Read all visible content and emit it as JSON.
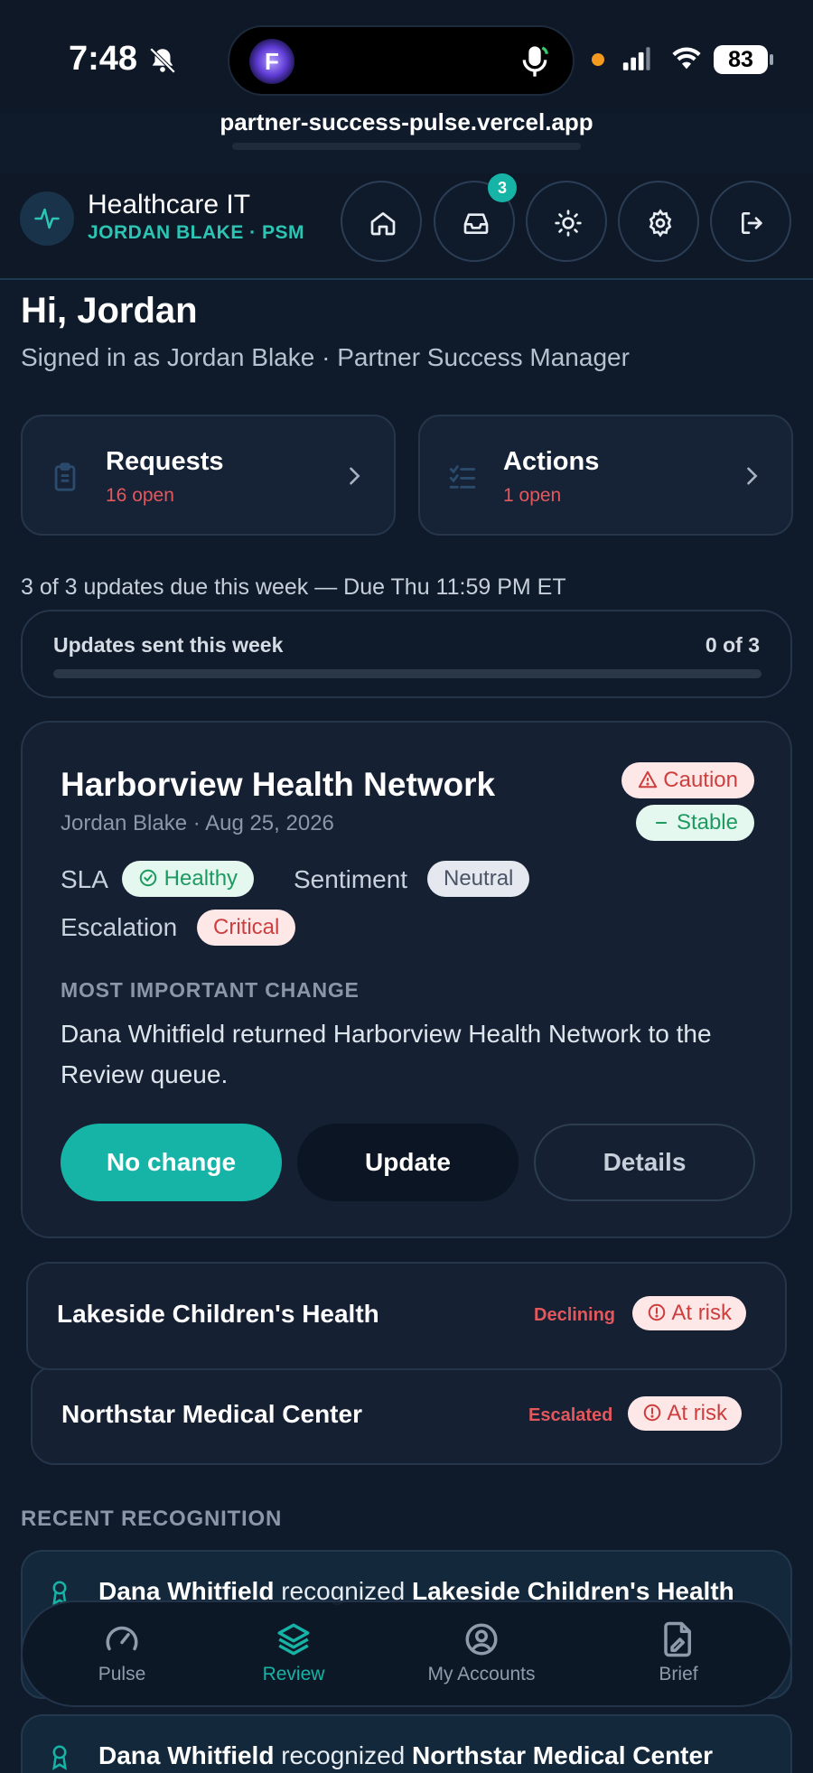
{
  "status_bar": {
    "time": "7:48",
    "battery": "83"
  },
  "browser": {
    "url": "partner-success-pulse.vercel.app",
    "app_letter": "F"
  },
  "header": {
    "org_title": "Healthcare IT",
    "org_subtitle": "JORDAN BLAKE · PSM",
    "inbox_badge": "3"
  },
  "greeting": {
    "title": "Hi, Jordan",
    "subtitle": "Signed in as Jordan Blake · Partner Success Manager"
  },
  "quick_cards": [
    {
      "title": "Requests",
      "count": "16 open"
    },
    {
      "title": "Actions",
      "count": "1 open"
    }
  ],
  "updates": {
    "due_line": "3 of 3 updates due this week — Due Thu 11:59 PM ET",
    "label": "Updates sent this week",
    "value": "0 of 3",
    "progress_fraction": 0
  },
  "account": {
    "name": "Harborview Health Network",
    "meta": "Jordan Blake · Aug 25, 2026",
    "badge_caution": "Caution",
    "badge_trend": "Stable",
    "sla_label": "SLA",
    "sla_value": "Healthy",
    "sentiment_label": "Sentiment",
    "sentiment_value": "Neutral",
    "escalation_label": "Escalation",
    "escalation_value": "Critical",
    "change_label": "MOST IMPORTANT CHANGE",
    "change_text": "Dana Whitfield returned Harborview Health Network to the Review queue.",
    "buttons": {
      "no_change": "No change",
      "update": "Update",
      "details": "Details"
    }
  },
  "queue": [
    {
      "name": "Lakeside Children's Health",
      "tag": "Declining",
      "status": "At risk"
    },
    {
      "name": "Northstar Medical Center",
      "tag": "Escalated",
      "status": "At risk"
    }
  ],
  "recognition": {
    "title": "RECENT RECOGNITION",
    "items": [
      {
        "who": "Dana Whitfield",
        "verb": "recognized",
        "target": "Lakeside Children's Health"
      },
      {
        "who": "Dana Whitfield",
        "verb": "recognized",
        "target": "Northstar Medical Center"
      }
    ]
  },
  "nav": [
    {
      "label": "Pulse",
      "icon": "gauge-icon"
    },
    {
      "label": "Review",
      "icon": "layers-icon"
    },
    {
      "label": "My Accounts",
      "icon": "user-circle-icon"
    },
    {
      "label": "Brief",
      "icon": "document-icon"
    }
  ],
  "colors": {
    "accent": "#16b4a6",
    "danger": "#e3585d",
    "success": "#1e9a61",
    "background": "#0f1a2a"
  }
}
